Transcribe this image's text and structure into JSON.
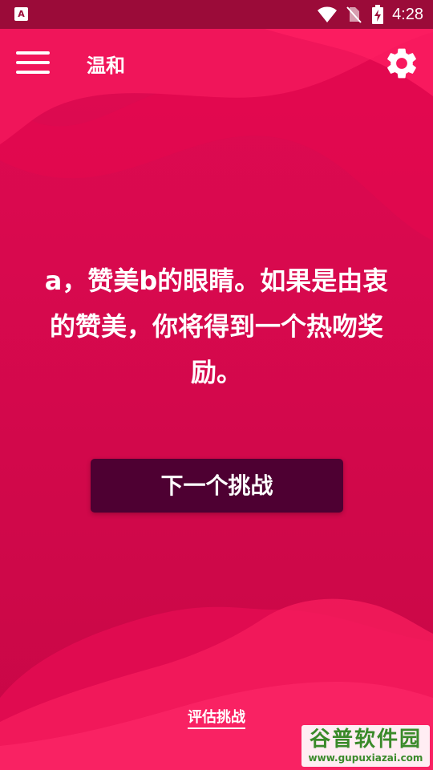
{
  "status_bar": {
    "app_icon_glyph": "A",
    "time": "4:28",
    "icons": [
      "wifi-icon",
      "no-sim-icon",
      "battery-charging-icon"
    ]
  },
  "app_bar": {
    "title": "温和",
    "menu_icon": "hamburger-menu-icon",
    "settings_icon": "gear-icon"
  },
  "challenge": {
    "text": "a，赞美b的眼睛。如果是由衷的赞美，你将得到一个热吻奖励。"
  },
  "actions": {
    "next_challenge_label": "下一个挑战",
    "rate_challenge_label": "评估挑战"
  },
  "watermark": {
    "title": "谷普软件园",
    "url": "www.gupuxiazai.com"
  },
  "colors": {
    "background": "#d6094a",
    "status_bar": "#9b0b39",
    "button": "#4e0032",
    "text": "#ffffff"
  }
}
